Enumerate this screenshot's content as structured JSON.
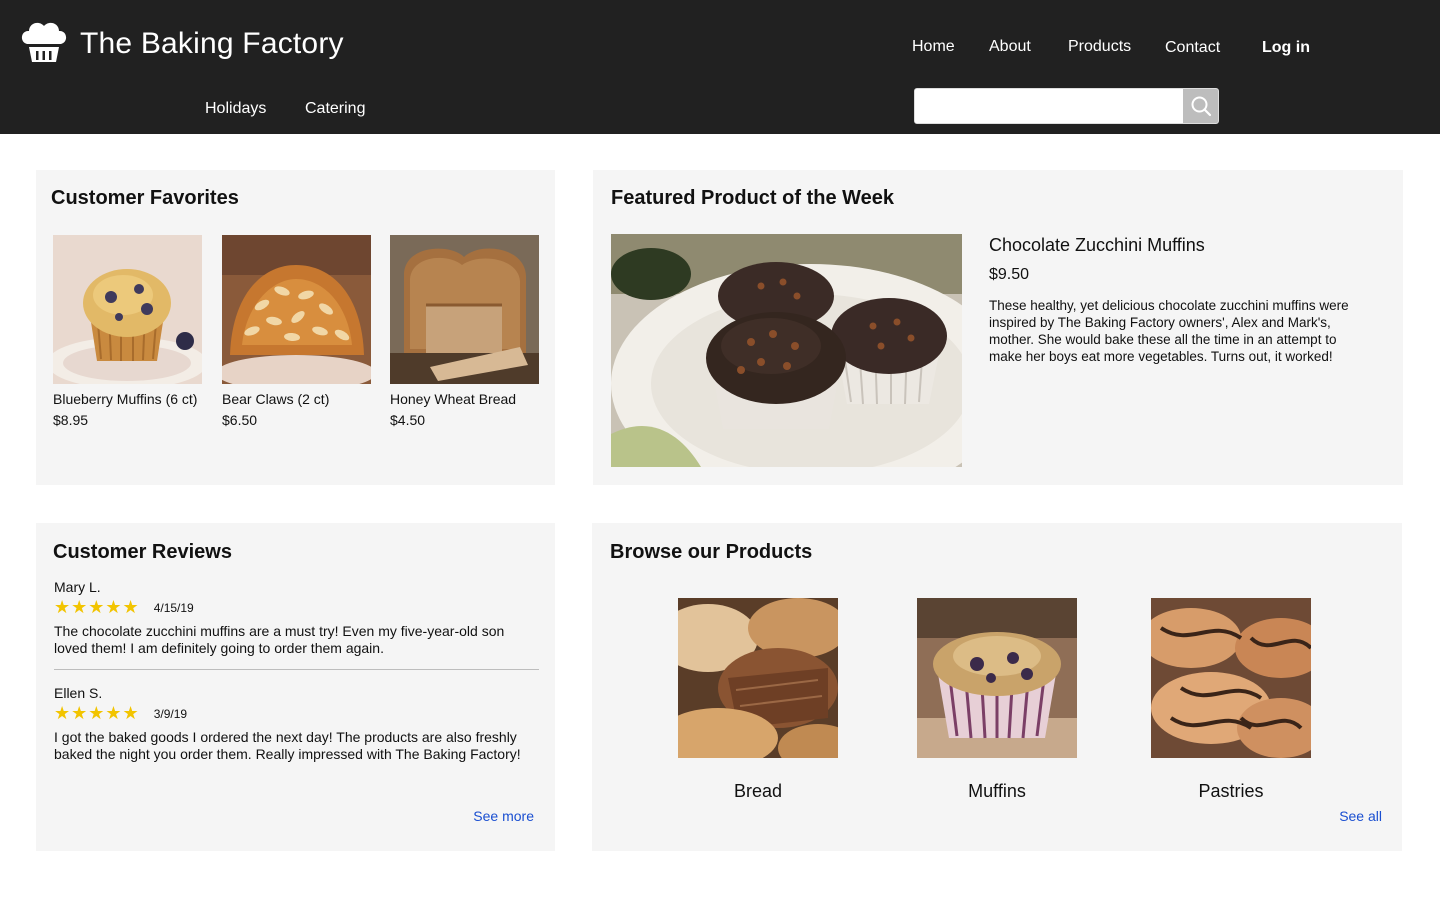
{
  "header": {
    "brand": "The Baking Factory",
    "logo_icon": "cupcake-icon",
    "nav": {
      "home": "Home",
      "about": "About",
      "products": "Products",
      "contact": "Contact",
      "login": "Log in",
      "holidays": "Holidays",
      "catering": "Catering"
    },
    "search": {
      "value": "",
      "placeholder": "",
      "icon": "search-icon"
    }
  },
  "favorites": {
    "title": "Customer Favorites",
    "items": [
      {
        "name": "Blueberry Muffins (6 ct)",
        "price": "$8.95"
      },
      {
        "name": "Bear Claws (2 ct)",
        "price": "$6.50"
      },
      {
        "name": "Honey Wheat Bread",
        "price": "$4.50"
      }
    ]
  },
  "featured": {
    "title": "Featured Product of the Week",
    "name": "Chocolate Zucchini Muffins",
    "price": "$9.50",
    "description": "These healthy, yet delicious chocolate zucchini muffins were inspired by The Baking Factory owners', Alex and Mark's, mother. She would bake these all the time in an attempt to make her boys eat more vegetables. Turns out, it worked!"
  },
  "reviews": {
    "title": "Customer Reviews",
    "items": [
      {
        "author": "Mary L.",
        "stars": "★★★★★",
        "rating": 5,
        "date": "4/15/19",
        "text": "The chocolate zucchini muffins are a must try! Even my five-year-old son loved them! I am definitely going to order them again."
      },
      {
        "author": "Ellen S.",
        "stars": "★★★★★",
        "rating": 5,
        "date": "3/9/19",
        "text": "I got the baked goods I ordered the next day! The products are also freshly baked the night you order them. Really impressed with The Baking Factory!"
      }
    ],
    "see_more": "See more"
  },
  "browse": {
    "title": "Browse our Products",
    "categories": [
      {
        "label": "Bread"
      },
      {
        "label": "Muffins"
      },
      {
        "label": "Pastries"
      }
    ],
    "see_all": "See all"
  },
  "colors": {
    "header_bg": "#212121",
    "panel_bg": "#f5f5f5",
    "link": "#1a4fd1",
    "star": "#f2c400"
  }
}
